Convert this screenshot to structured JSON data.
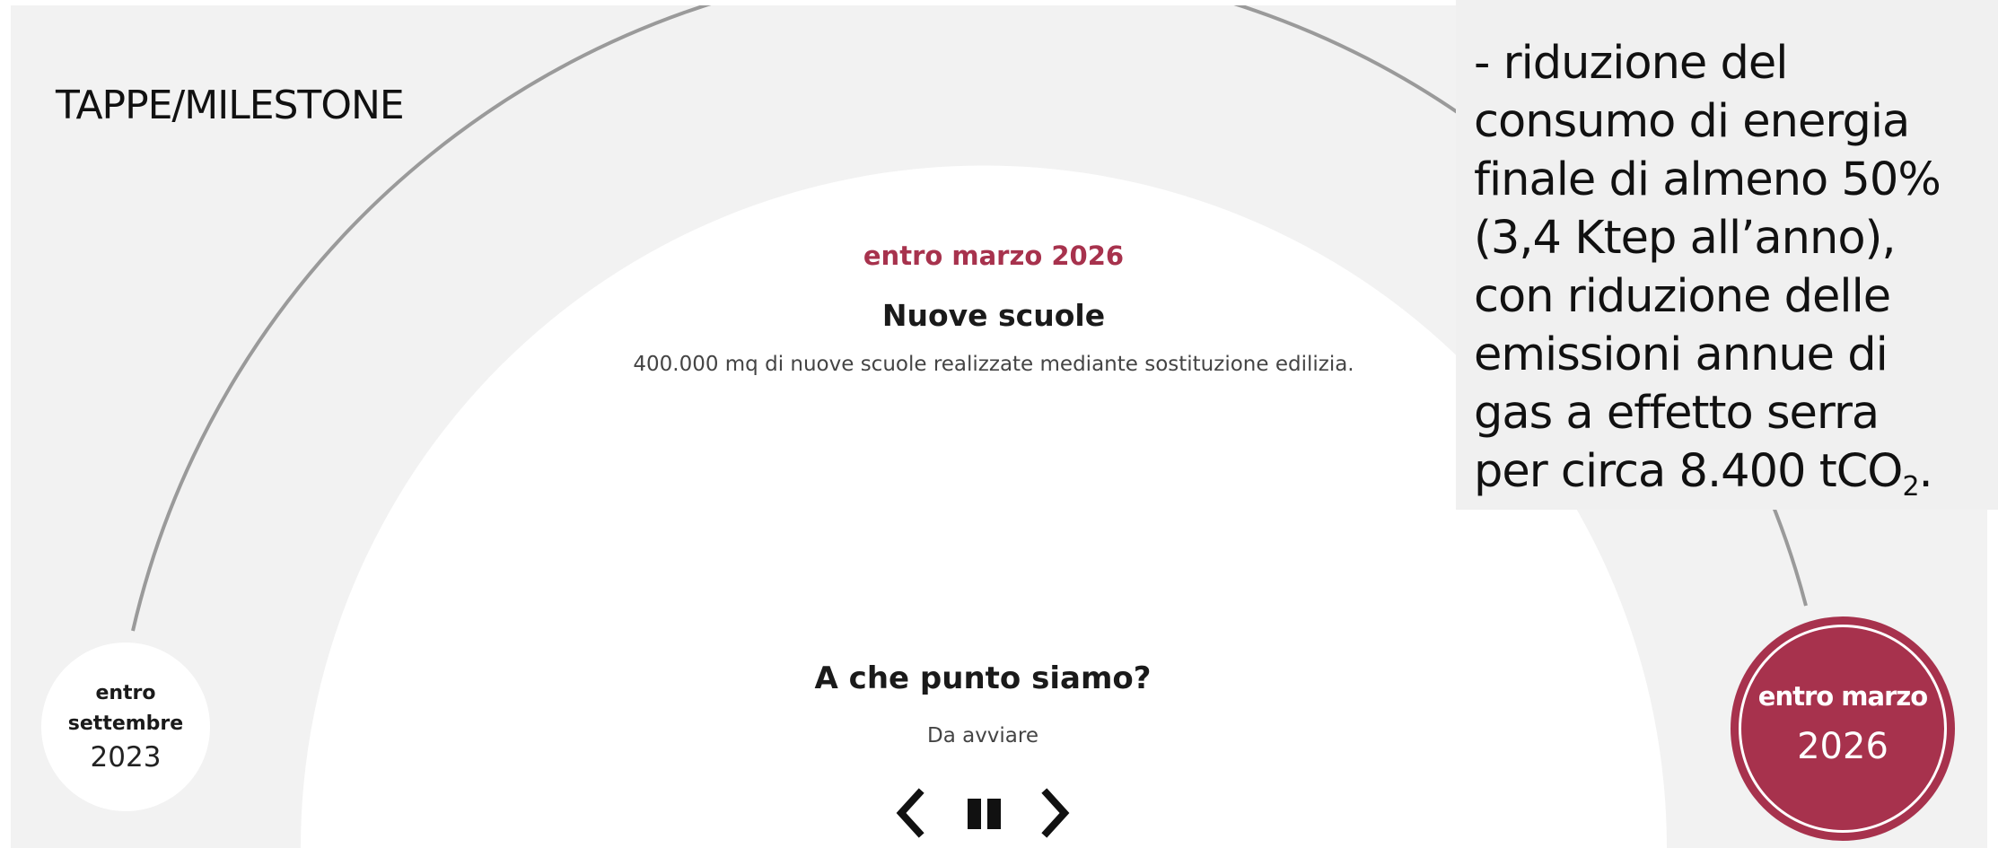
{
  "section": {
    "title": "TAPPE/MILESTONE"
  },
  "milestone": {
    "date": "entro marzo 2026",
    "title": "Nuove scuole",
    "description": "400.000 mq di nuove scuole realizzate mediante sostituzione edilizia."
  },
  "status": {
    "heading": "A che punto siamo?",
    "value": "Da avviare"
  },
  "controls": {
    "prev_icon": "chevron-left-icon",
    "pause_icon": "pause-icon",
    "next_icon": "chevron-right-icon"
  },
  "timeline": {
    "start": {
      "month": "entro settembre",
      "month_line1": "entro",
      "month_line2": "settembre",
      "year": "2023"
    },
    "end": {
      "month": "entro marzo",
      "year": "2026"
    }
  },
  "overlay": {
    "lines": [
      "- riduzione del",
      "consumo di energia",
      "finale di almeno 50%",
      "(3,4 Ktep all’anno),",
      "con riduzione delle",
      "emissioni annue di",
      "gas a effetto serra",
      "per circa 8.400 tCO"
    ],
    "subscript": "2",
    "trailing": "."
  },
  "colors": {
    "accent": "#a7324d",
    "panel": "#f2f2f2",
    "arc": "#999999"
  }
}
